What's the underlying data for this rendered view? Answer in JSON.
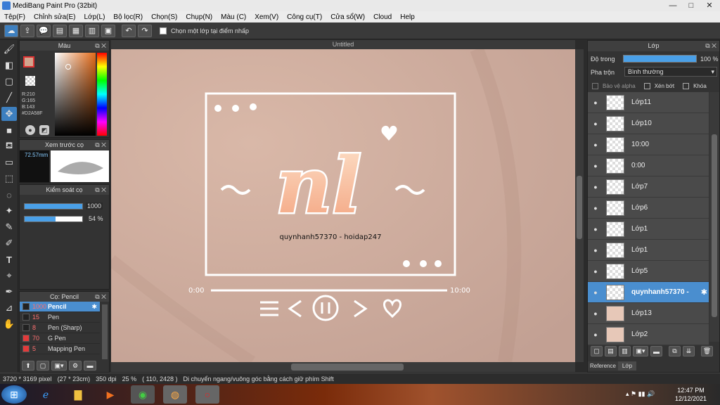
{
  "window": {
    "title": "MediBang Paint Pro (32bit)",
    "min": "—",
    "max": "□",
    "close": "✕"
  },
  "menu": [
    "Tệp(F)",
    "Chỉnh sửa(E)",
    "Lớp(L)",
    "Bộ lọc(R)",
    "Chọn(S)",
    "Chụp(N)",
    "Màu (C)",
    "Xem(V)",
    "Công cụ(T)",
    "Cửa sổ(W)",
    "Cloud",
    "Help"
  ],
  "toolbar": {
    "checkbox_label": "Chọn một lớp tại điểm nhấp"
  },
  "color_panel": {
    "title": "Màu",
    "r": "R:210",
    "g": "G:165",
    "b": "B:143",
    "hex": "#D2A58F",
    "main_color": "#D2A58F"
  },
  "brush_preview": {
    "title": "Xem trước cọ",
    "size_label": "72.57mm"
  },
  "brush_control": {
    "title": "Kiểm soát cọ",
    "size_value": "1000",
    "opacity_value": "54 %",
    "opacity_fraction": 0.54,
    "size_fraction": 1.0
  },
  "brush_panel": {
    "title": "Cọ: Pencil",
    "items": [
      {
        "size": "1000",
        "name": "Pencil",
        "color": "#222222",
        "selected": true
      },
      {
        "size": "15",
        "name": "Pen",
        "color": "#222222"
      },
      {
        "size": "8",
        "name": "Pen (Sharp)",
        "color": "#222222"
      },
      {
        "size": "70",
        "name": "G Pen",
        "color": "#e23b3b"
      },
      {
        "size": "5",
        "name": "Mapping Pen",
        "color": "#e23b3b"
      }
    ]
  },
  "document": {
    "tab": "Untitled",
    "time_start": "0:00",
    "time_end": "10:00",
    "credit": "quynhanh57370 - hoidap247",
    "text": "nl"
  },
  "layer_panel": {
    "title": "Lớp",
    "opacity_label": "Độ trong",
    "opacity_value": "100 %",
    "blend_label": "Pha trộn",
    "blend_value": "Bình thường",
    "protect_alpha": "Bảo vệ alpha",
    "clipping": "Xén bớt",
    "lock": "Khóa",
    "layers": [
      {
        "name": "Lớp11"
      },
      {
        "name": "Lớp10"
      },
      {
        "name": "10:00"
      },
      {
        "name": "0:00"
      },
      {
        "name": "Lớp7"
      },
      {
        "name": "Lớp6"
      },
      {
        "name": "Lớp1"
      },
      {
        "name": "Lớp1"
      },
      {
        "name": "Lớp5"
      },
      {
        "name": "quynhanh57370 -",
        "selected": true
      },
      {
        "name": "Lớp13"
      },
      {
        "name": "Lớp2"
      }
    ],
    "tab_reference": "Reference",
    "tab_layer": "Lớp"
  },
  "status": {
    "size": "3720 * 3169 pixel",
    "cm": "(27 * 23cm)",
    "dpi": "350 dpi",
    "zoom": "25 %",
    "coords": "( 110, 2428 )",
    "hint": "Di chuyển ngang/vuông góc bằng cách giữ phím Shift"
  },
  "taskbar": {
    "time": "12:47 PM",
    "date": "12/12/2021"
  }
}
